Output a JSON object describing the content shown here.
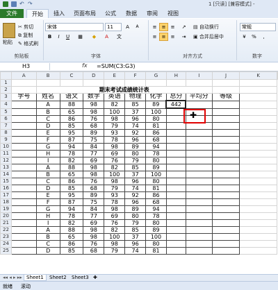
{
  "window": {
    "title": "1 [只读] [兼容模式] -"
  },
  "tabs": [
    "文件",
    "开始",
    "插入",
    "页面布局",
    "公式",
    "数据",
    "审阅",
    "视图"
  ],
  "clipboard": {
    "paste": "粘贴",
    "cut": "剪切",
    "copy": "复制",
    "format_painter": "格式刷",
    "label": "剪贴板"
  },
  "font": {
    "name": "宋体",
    "size": "11",
    "label": "字体",
    "bold": "B",
    "italic": "I",
    "underline": "U"
  },
  "alignment": {
    "wrap": "自动换行",
    "merge": "合并后居中",
    "label": "对齐方式"
  },
  "number": {
    "format": "常规",
    "percent": "%",
    "comma": ",",
    "label": "数字"
  },
  "formula_bar": {
    "cell": "H3",
    "fx": "fx",
    "formula": "=SUM(C3:G3)"
  },
  "columns": [
    "A",
    "B",
    "C",
    "D",
    "E",
    "F",
    "G",
    "H",
    "I",
    "J",
    "K"
  ],
  "sheet_title": "期末考试成绩统计表",
  "headers": [
    "学号",
    "姓名",
    "语文",
    "数学",
    "英语",
    "物理",
    "化学",
    "总分",
    "平均分",
    "等级"
  ],
  "rows": [
    [
      "A",
      "88",
      "98",
      "82",
      "85",
      "89",
      "442"
    ],
    [
      "B",
      "65",
      "98",
      "100",
      "37",
      "100",
      ""
    ],
    [
      "C",
      "86",
      "76",
      "98",
      "96",
      "80",
      ""
    ],
    [
      "D",
      "85",
      "68",
      "79",
      "74",
      "81",
      ""
    ],
    [
      "E",
      "95",
      "89",
      "93",
      "92",
      "86",
      ""
    ],
    [
      "F",
      "87",
      "75",
      "78",
      "96",
      "68",
      ""
    ],
    [
      "G",
      "94",
      "84",
      "98",
      "89",
      "94",
      ""
    ],
    [
      "H",
      "78",
      "77",
      "69",
      "80",
      "78",
      ""
    ],
    [
      "I",
      "82",
      "69",
      "76",
      "79",
      "80",
      ""
    ],
    [
      "A",
      "88",
      "98",
      "82",
      "85",
      "89",
      ""
    ],
    [
      "B",
      "65",
      "98",
      "100",
      "37",
      "100",
      ""
    ],
    [
      "C",
      "86",
      "76",
      "98",
      "96",
      "80",
      ""
    ],
    [
      "D",
      "85",
      "68",
      "79",
      "74",
      "81",
      ""
    ],
    [
      "E",
      "95",
      "89",
      "93",
      "92",
      "86",
      ""
    ],
    [
      "F",
      "87",
      "75",
      "78",
      "96",
      "68",
      ""
    ],
    [
      "G",
      "94",
      "84",
      "98",
      "89",
      "94",
      ""
    ],
    [
      "H",
      "78",
      "77",
      "69",
      "80",
      "78",
      ""
    ],
    [
      "I",
      "82",
      "69",
      "76",
      "79",
      "80",
      ""
    ],
    [
      "A",
      "88",
      "98",
      "82",
      "85",
      "89",
      ""
    ],
    [
      "B",
      "65",
      "98",
      "100",
      "37",
      "100",
      ""
    ],
    [
      "C",
      "86",
      "76",
      "98",
      "96",
      "80",
      ""
    ],
    [
      "D",
      "85",
      "68",
      "79",
      "74",
      "81",
      ""
    ]
  ],
  "sheets": [
    "Sheet1",
    "Sheet2",
    "Sheet3"
  ],
  "status": {
    "ready": "就绪",
    "scroll": "滚动"
  },
  "colors": {
    "file_tab": "#2a7a2a",
    "highlight": "#e00000",
    "ribbon": "#e4ecf6"
  }
}
